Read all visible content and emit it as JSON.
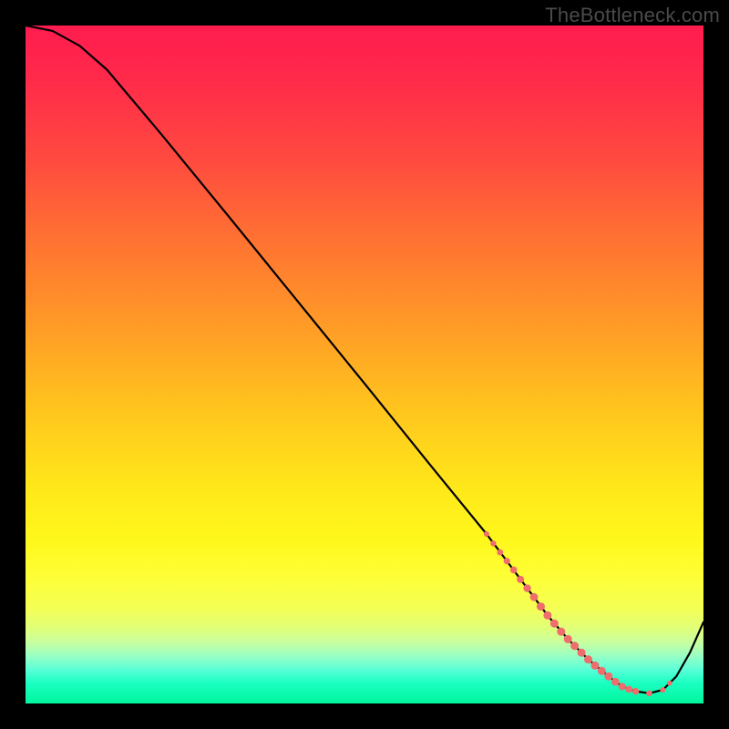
{
  "watermark": "TheBottleneck.com",
  "chart_data": {
    "type": "line",
    "title": "",
    "xlabel": "",
    "ylabel": "",
    "xlim": [
      0,
      100
    ],
    "ylim": [
      0,
      100
    ],
    "grid": false,
    "series": [
      {
        "name": "curve",
        "color": "#000000",
        "x": [
          0,
          4,
          8,
          12,
          20,
          30,
          40,
          50,
          60,
          68,
          71,
          74,
          77,
          80,
          83,
          86,
          88,
          90,
          92,
          94,
          96,
          98,
          100
        ],
        "y": [
          100,
          99.2,
          97.0,
          93.5,
          84.0,
          71.8,
          59.5,
          47.2,
          34.8,
          25.0,
          21.0,
          17.0,
          13.0,
          9.5,
          6.5,
          4.0,
          2.5,
          1.8,
          1.5,
          2.0,
          4.0,
          7.5,
          12.0
        ]
      }
    ],
    "markers": {
      "name": "highlighted-points",
      "color": "#ef6d6d",
      "points": [
        {
          "x": 68.0,
          "y": 25.0,
          "r": 3.0
        },
        {
          "x": 69.0,
          "y": 23.6,
          "r": 3.2
        },
        {
          "x": 70.0,
          "y": 22.3,
          "r": 3.4
        },
        {
          "x": 71.0,
          "y": 21.0,
          "r": 3.6
        },
        {
          "x": 72.0,
          "y": 19.7,
          "r": 3.8
        },
        {
          "x": 73.0,
          "y": 18.3,
          "r": 4.0
        },
        {
          "x": 74.0,
          "y": 17.0,
          "r": 4.2
        },
        {
          "x": 75.0,
          "y": 15.7,
          "r": 4.4
        },
        {
          "x": 76.0,
          "y": 14.3,
          "r": 4.5
        },
        {
          "x": 77.0,
          "y": 13.0,
          "r": 4.5
        },
        {
          "x": 78.0,
          "y": 11.8,
          "r": 4.5
        },
        {
          "x": 79.0,
          "y": 10.6,
          "r": 4.5
        },
        {
          "x": 80.0,
          "y": 9.5,
          "r": 4.5
        },
        {
          "x": 81.0,
          "y": 8.5,
          "r": 4.5
        },
        {
          "x": 82.0,
          "y": 7.5,
          "r": 4.5
        },
        {
          "x": 83.0,
          "y": 6.5,
          "r": 4.5
        },
        {
          "x": 84.0,
          "y": 5.6,
          "r": 4.5
        },
        {
          "x": 85.0,
          "y": 4.8,
          "r": 4.5
        },
        {
          "x": 86.0,
          "y": 4.0,
          "r": 4.5
        },
        {
          "x": 87.0,
          "y": 3.2,
          "r": 4.3
        },
        {
          "x": 88.0,
          "y": 2.5,
          "r": 4.1
        },
        {
          "x": 89.0,
          "y": 2.1,
          "r": 3.9
        },
        {
          "x": 90.0,
          "y": 1.8,
          "r": 3.7
        },
        {
          "x": 92.0,
          "y": 1.5,
          "r": 3.3
        },
        {
          "x": 94.0,
          "y": 2.0,
          "r": 3.0
        },
        {
          "x": 95.0,
          "y": 3.0,
          "r": 2.8
        }
      ]
    },
    "gradient_stops": [
      {
        "offset": 0,
        "color": "#ff1c4f"
      },
      {
        "offset": 8,
        "color": "#ff2a4a"
      },
      {
        "offset": 20,
        "color": "#ff4b3f"
      },
      {
        "offset": 32,
        "color": "#ff7332"
      },
      {
        "offset": 44,
        "color": "#ff9a27"
      },
      {
        "offset": 56,
        "color": "#ffc31e"
      },
      {
        "offset": 68,
        "color": "#ffe71a"
      },
      {
        "offset": 76,
        "color": "#fff81c"
      },
      {
        "offset": 82,
        "color": "#fdff3a"
      },
      {
        "offset": 86,
        "color": "#f4ff56"
      },
      {
        "offset": 89,
        "color": "#e0ff7a"
      },
      {
        "offset": 91,
        "color": "#c8ffa0"
      },
      {
        "offset": 93,
        "color": "#98ffc4"
      },
      {
        "offset": 95,
        "color": "#5affd8"
      },
      {
        "offset": 97,
        "color": "#1affc2"
      },
      {
        "offset": 100,
        "color": "#00f59c"
      }
    ]
  }
}
